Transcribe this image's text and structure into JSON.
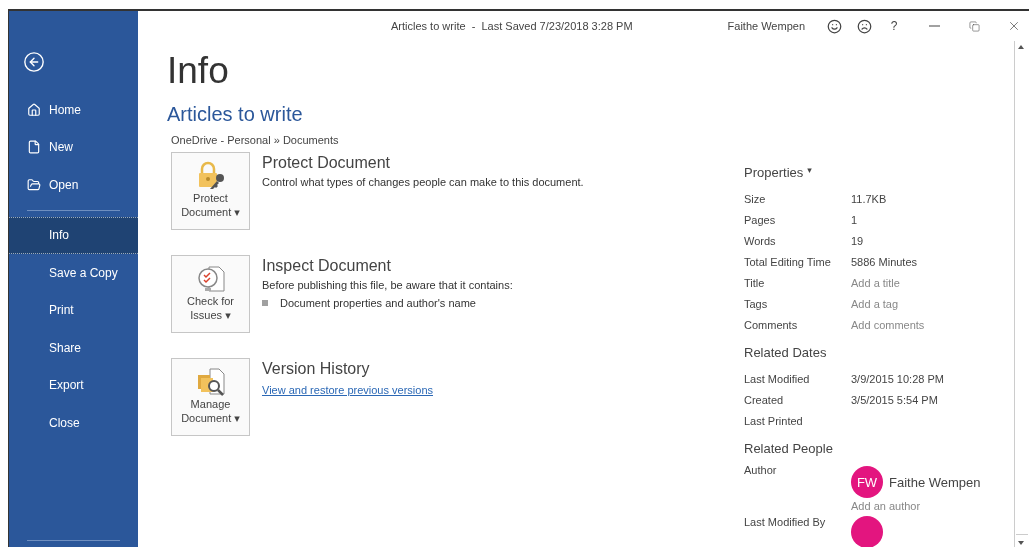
{
  "title_bar": {
    "document": "Articles to write",
    "separator": "-",
    "saved": "Last Saved 7/23/2018 3:28 PM",
    "user": "Faithe Wempen",
    "help": "?"
  },
  "sidebar": {
    "items": [
      {
        "label": "Home",
        "selected": false
      },
      {
        "label": "New",
        "selected": false
      },
      {
        "label": "Open",
        "selected": false
      },
      {
        "label": "Info",
        "selected": true
      },
      {
        "label": "Save a Copy",
        "selected": false
      },
      {
        "label": "Print",
        "selected": false
      },
      {
        "label": "Share",
        "selected": false
      },
      {
        "label": "Export",
        "selected": false
      },
      {
        "label": "Close",
        "selected": false
      }
    ]
  },
  "page": {
    "heading": "Info",
    "document_title": "Articles to write",
    "path": "OneDrive - Personal » Documents"
  },
  "sections": [
    {
      "button": [
        "Protect",
        "Document"
      ],
      "caret": "▾",
      "title": "Protect Document",
      "description": "Control what types of changes people can make to this document."
    },
    {
      "button": [
        "Check for",
        "Issues"
      ],
      "caret": "▾",
      "title": "Inspect Document",
      "description": "Before publishing this file, be aware that it contains:",
      "bullets": [
        "Document properties and author's name"
      ]
    },
    {
      "button": [
        "Manage",
        "Document"
      ],
      "caret": "▾",
      "title": "Version History",
      "link": "View and restore previous versions"
    }
  ],
  "properties": {
    "heading": "Properties",
    "caret": "▾",
    "rows": [
      {
        "label": "Size",
        "value": "11.7KB",
        "kind": "value"
      },
      {
        "label": "Pages",
        "value": "1",
        "kind": "value"
      },
      {
        "label": "Words",
        "value": "19",
        "kind": "value"
      },
      {
        "label": "Total Editing Time",
        "value": "5886 Minutes",
        "kind": "value"
      },
      {
        "label": "Title",
        "placeholder": "Add a title",
        "kind": "hint"
      },
      {
        "label": "Tags",
        "placeholder": "Add a tag",
        "kind": "hint"
      },
      {
        "label": "Comments",
        "placeholder": "Add comments",
        "kind": "hint"
      }
    ]
  },
  "related_dates": {
    "heading": "Related Dates",
    "rows": [
      {
        "label": "Last Modified",
        "value": "3/9/2015 10:28 PM"
      },
      {
        "label": "Created",
        "value": "3/5/2015 5:54 PM"
      },
      {
        "label": "Last Printed"
      }
    ]
  },
  "related_people": {
    "heading": "Related People",
    "author_label": "Author",
    "author": {
      "initials": "FW",
      "name": "Faithe Wempen",
      "color": "#e3157f"
    },
    "add_author": "Add an author",
    "last_modified_by_label": "Last Modified By",
    "last_modified_by": {
      "color": "#e3157f"
    }
  }
}
